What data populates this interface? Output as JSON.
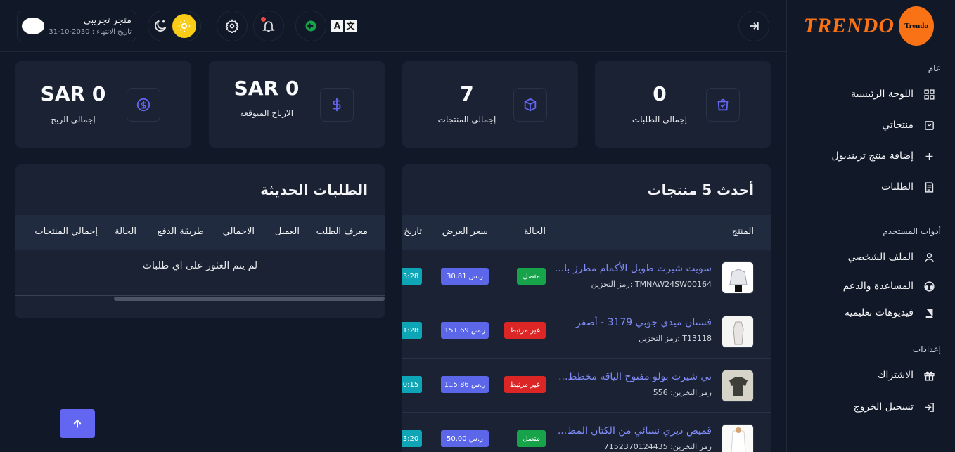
{
  "brand": {
    "logo_text": "TRENDO",
    "badge_text": "Trendo"
  },
  "sidebar": {
    "section_general": "عام",
    "section_user_tools": "أدوات المستخدم",
    "section_settings": "إعدادات",
    "items": [
      {
        "label": "اللوحة الرئيسية",
        "icon": "dashboard-icon"
      },
      {
        "label": "منتجاتي",
        "icon": "shopping-bag-icon"
      },
      {
        "label": "إضافة منتج ترينديول",
        "icon": "plus-icon"
      },
      {
        "label": "الطلبات",
        "icon": "orders-icon"
      },
      {
        "label": "الملف الشخصي",
        "icon": "user-icon"
      },
      {
        "label": "المساعدة والدعم",
        "icon": "headset-icon"
      },
      {
        "label": "فيديوهات تعليمية",
        "icon": "book-icon"
      },
      {
        "label": "الاشتراك",
        "icon": "subscription-icon"
      },
      {
        "label": "تسجيل الخروج",
        "icon": "logout-icon"
      }
    ]
  },
  "topbar": {
    "store_name": "متجر تجريبي",
    "store_expiry": "تاريخ الانتهاء : 2030-10-31",
    "colors": {
      "notification_dot": "#ef4444",
      "status_green": "#16a34a",
      "sun": "#facc15"
    }
  },
  "stats": [
    {
      "value": "0",
      "label": "إجمالي الطلبات",
      "icon": "bag-check-icon"
    },
    {
      "value": "7",
      "label": "إجمالي المنتجات",
      "icon": "box-icon"
    },
    {
      "value": "SAR 0",
      "label": "الارباح المتوقعة",
      "icon": "dollar-icon"
    },
    {
      "value": "SAR 0",
      "label": "إجمالي الربح",
      "icon": "coin-icon"
    }
  ],
  "latest_products": {
    "title": "أحدث 5 منتجات",
    "columns": {
      "product": "المنتج",
      "status": "الحالة",
      "price": "سعر العرض",
      "date": "تاريخ"
    },
    "rows": [
      {
        "name": "سويت شيرت طويل الأكمام مطرز با...",
        "sku": "رمز التخزين: TMNAW24SW00164",
        "status": "متصل",
        "price": "30.81 ر.س",
        "time": "3:28"
      },
      {
        "name": "فستان ميدي جوبي 3179 - أصفر",
        "sku": "رمز التخزين: T13118",
        "status": "غير مرتبط",
        "price": "151.69 ر.س",
        "time": "1:28"
      },
      {
        "name": "تي شيرت بولو مفتوح الياقة مخطط...",
        "sku": "رمز التخزين: 556",
        "status": "غير مرتبط",
        "price": "115.86 ر.س",
        "time": "0:15"
      },
      {
        "name": "قميص ديزي نسائي من الكتان المط...",
        "sku": "رمز التخزين: 7152370124435",
        "status": "متصل",
        "price": "50.00 ر.س",
        "time": "3:20"
      }
    ]
  },
  "recent_orders": {
    "title": "الطلبات الحديثة",
    "columns": {
      "order_id": "معرف الطلب",
      "customer": "العميل",
      "total": "الاجمالي",
      "payment": "طريقة الدفع",
      "status": "الحالة",
      "products_total": "إجمالي المنتجات"
    },
    "empty_message": "لم يتم العثور على اي طلبات"
  }
}
